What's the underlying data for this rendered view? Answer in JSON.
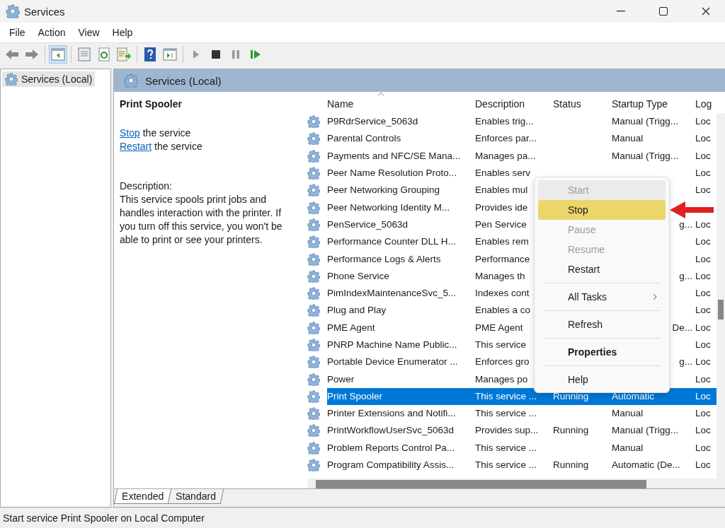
{
  "window": {
    "title": "Services"
  },
  "menu": [
    "File",
    "Action",
    "View",
    "Help"
  ],
  "toolbar": [
    {
      "kind": "back",
      "selected": false,
      "disabled": false
    },
    {
      "kind": "forward",
      "selected": false,
      "disabled": false
    },
    {
      "kind": "tree",
      "selected": true,
      "disabled": false
    },
    {
      "kind": "properties",
      "selected": false,
      "disabled": false
    },
    {
      "kind": "refresh",
      "selected": false,
      "disabled": false
    },
    {
      "kind": "export",
      "selected": false,
      "disabled": false
    },
    {
      "kind": "help",
      "selected": false,
      "disabled": false
    },
    {
      "kind": "console",
      "selected": false,
      "disabled": false
    },
    {
      "kind": "play",
      "selected": false,
      "disabled": true
    },
    {
      "kind": "stop",
      "selected": false,
      "disabled": false
    },
    {
      "kind": "pause",
      "selected": false,
      "disabled": true
    },
    {
      "kind": "resume",
      "selected": false,
      "disabled": false
    }
  ],
  "tree": [
    {
      "label": "Services (Local)",
      "selected": true
    }
  ],
  "panel_title": "Services (Local)",
  "details": {
    "title": "Print Spooler",
    "actions": [
      {
        "link": "Stop",
        "text": "the service"
      },
      {
        "link": "Restart",
        "text": "the service"
      }
    ],
    "description_label": "Description:",
    "description": "This service spools print jobs and handles interaction with the printer. If you turn off this service, you won't be able to print or see your printers."
  },
  "table": {
    "columns": [
      "Name",
      "Description",
      "Status",
      "Startup Type",
      "Log"
    ],
    "rows": [
      {
        "name": "P9RdrService_5063d",
        "description": "Enables trig...",
        "startup": "Manual (Trigg...",
        "logon": "Loc",
        "selected": false
      },
      {
        "name": "Parental Controls",
        "description": "Enforces par...",
        "startup": "Manual",
        "logon": "Loc",
        "selected": false
      },
      {
        "name": "Payments and NFC/SE Mana...",
        "description": "Manages pa...",
        "startup": "Manual (Trigg...",
        "logon": "Loc",
        "selected": false
      },
      {
        "name": "Peer Name Resolution Proto...",
        "description": "Enables serv",
        "logon": "Loc",
        "selected": false
      },
      {
        "name": "Peer Networking Grouping",
        "description": "Enables mul",
        "logon": "Loc",
        "selected": false
      },
      {
        "name": "Peer Networking Identity M...",
        "description": "Provides ide",
        "selected": false
      },
      {
        "name": "PenService_5063d",
        "description": "Pen Service",
        "startup_tail": "g...",
        "logon": "Loc",
        "selected": false
      },
      {
        "name": "Performance Counter DLL H...",
        "description": "Enables rem",
        "logon": "Loc",
        "selected": false
      },
      {
        "name": "Performance Logs & Alerts",
        "description": "Performance",
        "logon": "Loc",
        "selected": false
      },
      {
        "name": "Phone Service",
        "description": "Manages th",
        "startup_tail": "g...",
        "logon": "Loc",
        "selected": false
      },
      {
        "name": "PimIndexMaintenanceSvc_5...",
        "description": "Indexes cont",
        "logon": "Loc",
        "selected": false
      },
      {
        "name": "Plug and Play",
        "description": "Enables a co",
        "logon": "Loc",
        "selected": false
      },
      {
        "name": "PME Agent",
        "description": "PME Agent",
        "startup_tail": "De...",
        "logon": "Loc",
        "selected": false
      },
      {
        "name": "PNRP Machine Name Public...",
        "description": "This service",
        "logon": "Loc",
        "selected": false
      },
      {
        "name": "Portable Device Enumerator ...",
        "description": "Enforces gro",
        "startup_tail": "g...",
        "logon": "Loc",
        "selected": false
      },
      {
        "name": "Power",
        "description": "Manages po",
        "logon": "Loc",
        "selected": false
      },
      {
        "name": "Print Spooler",
        "description": "This service ...",
        "status": "Running",
        "startup": "Automatic",
        "logon": "Loc",
        "selected": true
      },
      {
        "name": "Printer Extensions and Notifi...",
        "description": "This service ...",
        "startup": "Manual",
        "logon": "Loc",
        "selected": false
      },
      {
        "name": "PrintWorkflowUserSvc_5063d",
        "description": "Provides sup...",
        "status": "Running",
        "startup": "Manual (Trigg...",
        "logon": "Loc",
        "selected": false
      },
      {
        "name": "Problem Reports Control Pa...",
        "description": "This service ...",
        "startup": "Manual",
        "logon": "Loc",
        "selected": false
      },
      {
        "name": "Program Compatibility Assis...",
        "description": "This service ...",
        "status": "Running",
        "startup": "Automatic (De...",
        "logon": "Loc",
        "selected": false
      }
    ]
  },
  "context_menu": [
    {
      "kind": "item",
      "label": "Start",
      "disabled": true,
      "selected": false,
      "focused": true
    },
    {
      "kind": "item",
      "label": "Stop",
      "disabled": false,
      "selected": true,
      "focused": false
    },
    {
      "kind": "item",
      "label": "Pause",
      "disabled": true,
      "selected": false,
      "focused": false
    },
    {
      "kind": "item",
      "label": "Resume",
      "disabled": true,
      "selected": false,
      "focused": false
    },
    {
      "kind": "item",
      "label": "Restart",
      "disabled": false,
      "selected": false,
      "focused": false
    },
    {
      "kind": "separator"
    },
    {
      "kind": "submenu",
      "label": "All Tasks",
      "disabled": false,
      "selected": false,
      "focused": false
    },
    {
      "kind": "separator"
    },
    {
      "kind": "item",
      "label": "Refresh",
      "disabled": false,
      "selected": false,
      "focused": false
    },
    {
      "kind": "separator"
    },
    {
      "kind": "default",
      "label": "Properties",
      "disabled": false,
      "selected": false,
      "focused": false
    },
    {
      "kind": "separator"
    },
    {
      "kind": "item",
      "label": "Help",
      "disabled": false,
      "selected": false,
      "focused": false
    }
  ],
  "view_tabs": [
    {
      "label": "Extended",
      "selected": true
    },
    {
      "label": "Standard",
      "selected": false
    }
  ],
  "status_bar": "Start service Print Spooler on Local Computer"
}
